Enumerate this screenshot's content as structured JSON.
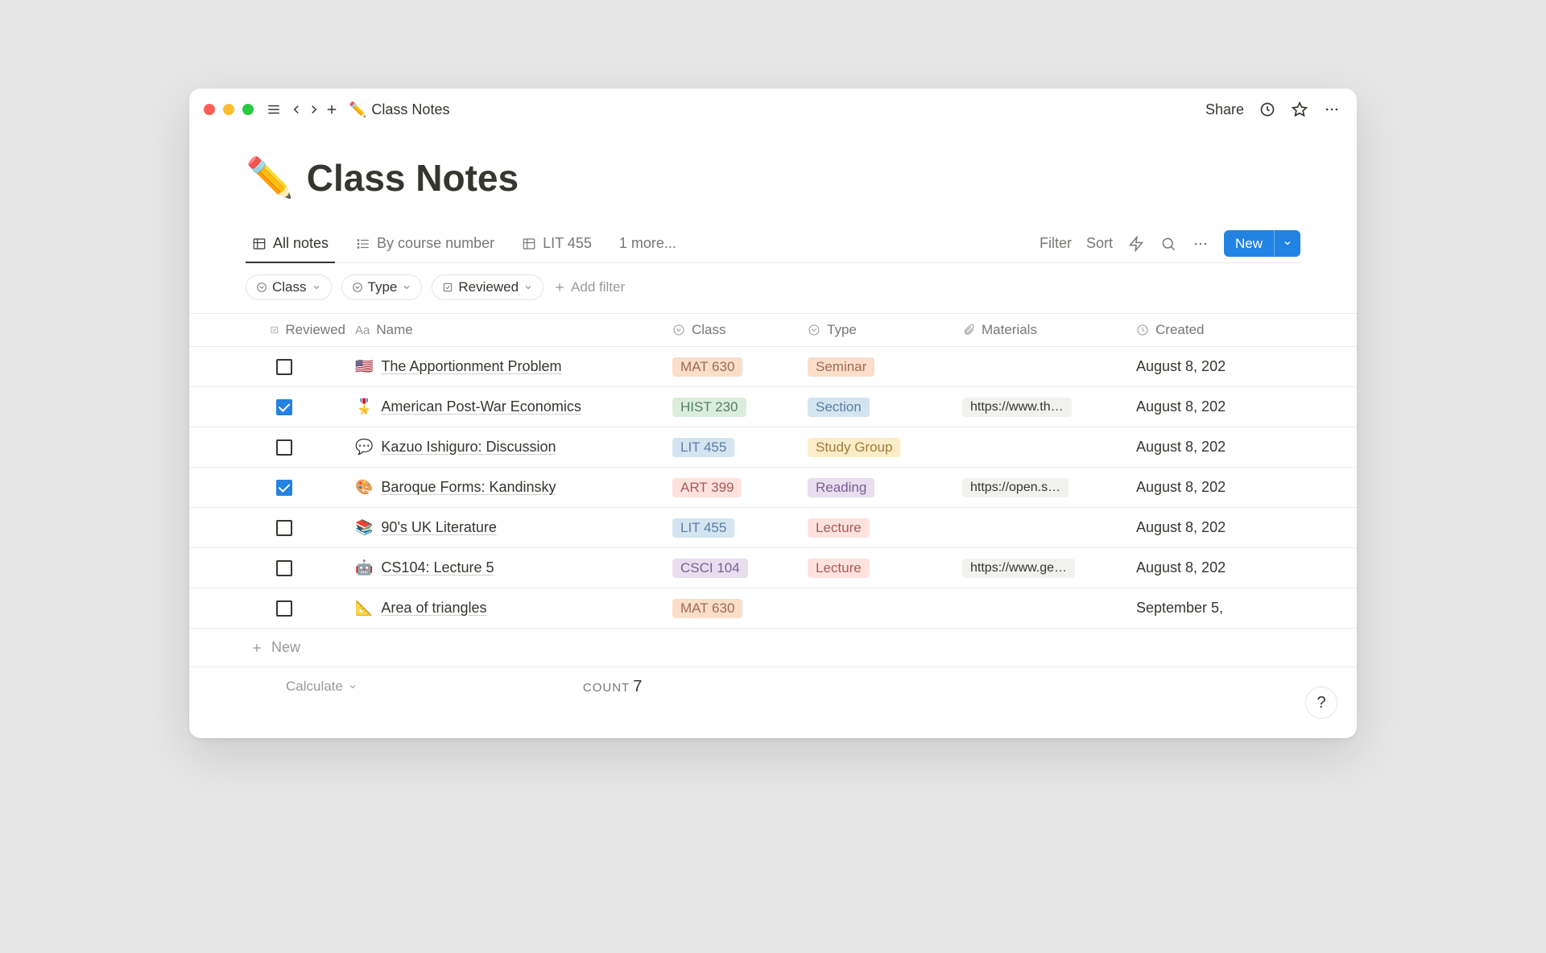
{
  "titlebar": {
    "breadcrumb_icon": "✏️",
    "breadcrumb_text": "Class Notes",
    "share": "Share"
  },
  "page": {
    "icon": "✏️",
    "title": "Class Notes"
  },
  "views": {
    "tabs": [
      {
        "label": "All notes",
        "icon": "table",
        "active": true
      },
      {
        "label": "By course number",
        "icon": "list",
        "active": false
      },
      {
        "label": "LIT 455",
        "icon": "table",
        "active": false
      },
      {
        "label": "1 more...",
        "icon": "",
        "active": false
      }
    ],
    "actions": {
      "filter": "Filter",
      "sort": "Sort",
      "new": "New"
    }
  },
  "filters": {
    "pills": [
      {
        "icon": "select",
        "label": "Class"
      },
      {
        "icon": "select",
        "label": "Type"
      },
      {
        "icon": "check",
        "label": "Reviewed"
      }
    ],
    "add": "Add filter"
  },
  "columns": {
    "reviewed": "Reviewed",
    "name": "Name",
    "class": "Class",
    "type": "Type",
    "materials": "Materials",
    "created": "Created"
  },
  "rows": [
    {
      "reviewed": false,
      "icon": "🇺🇸",
      "name": "The Apportionment Problem",
      "class": {
        "text": "MAT 630",
        "color": "orange"
      },
      "type": {
        "text": "Seminar",
        "color": "orange"
      },
      "materials": "",
      "created": "August 8, 202"
    },
    {
      "reviewed": true,
      "icon": "🎖️",
      "name": "American Post-War Economics",
      "class": {
        "text": "HIST 230",
        "color": "green"
      },
      "type": {
        "text": "Section",
        "color": "blue"
      },
      "materials": "https://www.th…",
      "created": "August 8, 202"
    },
    {
      "reviewed": false,
      "icon": "💬",
      "name": "Kazuo Ishiguro: Discussion",
      "class": {
        "text": "LIT 455",
        "color": "blue"
      },
      "type": {
        "text": "Study Group",
        "color": "yellow"
      },
      "materials": "",
      "created": "August 8, 202"
    },
    {
      "reviewed": true,
      "icon": "🎨",
      "name": "Baroque Forms: Kandinsky",
      "class": {
        "text": "ART 399",
        "color": "red"
      },
      "type": {
        "text": "Reading",
        "color": "purple"
      },
      "materials": "https://open.s…",
      "created": "August 8, 202"
    },
    {
      "reviewed": false,
      "icon": "📚",
      "name": "90's UK Literature",
      "class": {
        "text": "LIT 455",
        "color": "blue"
      },
      "type": {
        "text": "Lecture",
        "color": "red"
      },
      "materials": "",
      "created": "August 8, 202"
    },
    {
      "reviewed": false,
      "icon": "🤖",
      "name": "CS104: Lecture 5",
      "class": {
        "text": "CSCI 104",
        "color": "purple"
      },
      "type": {
        "text": "Lecture",
        "color": "red"
      },
      "materials": "https://www.ge…",
      "created": "August 8, 202"
    },
    {
      "reviewed": false,
      "icon": "📐",
      "name": "Area of triangles",
      "class": {
        "text": "MAT 630",
        "color": "orange"
      },
      "type": null,
      "materials": "",
      "created": "September 5,"
    }
  ],
  "new_row": "New",
  "footer": {
    "calculate": "Calculate",
    "count_label": "COUNT",
    "count_value": "7"
  },
  "help": "?"
}
